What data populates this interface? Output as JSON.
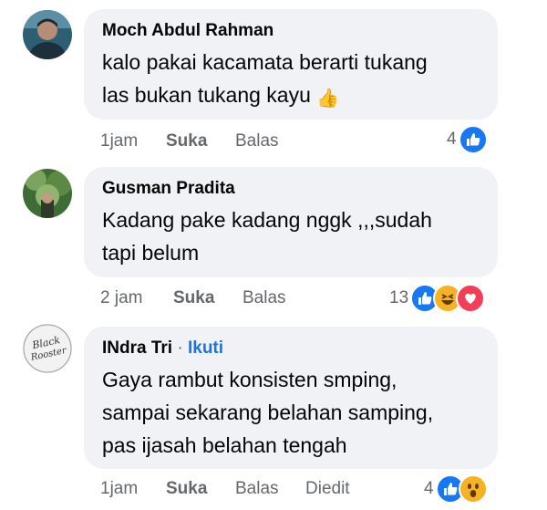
{
  "comments": [
    {
      "author": "Moch Abdul Rahman",
      "text_line1": "kalo pakai kacamata berarti tukang",
      "text_line2": "las bukan tukang kayu",
      "emoji": "👍",
      "time": "1jam",
      "like_label": "Suka",
      "reply_label": "Balas",
      "reaction_count": "4",
      "reactions": [
        "like-icon"
      ]
    },
    {
      "author": "Gusman Pradita",
      "text_line1": "Kadang pake kadang nggk ,,,sudah",
      "text_line2": "tapi belum",
      "time": "2 jam",
      "like_label": "Suka",
      "reply_label": "Balas",
      "reaction_count": "13",
      "reactions": [
        "like-icon",
        "haha-icon",
        "love-icon"
      ]
    },
    {
      "author": "INdra Tri",
      "separator": "·",
      "follow_label": "Ikuti",
      "text_line1": "Gaya rambut konsisten smping,",
      "text_line2": "sampai sekarang belahan samping,",
      "text_line3": "pas ijasah belahan tengah",
      "time": "1jam",
      "like_label": "Suka",
      "reply_label": "Balas",
      "edited_label": "Diedit",
      "reaction_count": "4",
      "reactions": [
        "like-icon",
        "wow-icon"
      ],
      "avatar_text": "Black Rooster"
    }
  ],
  "colors": {
    "bubble": "#f0f2f5",
    "meta": "#65676b",
    "follow": "#1b74e4",
    "like": "#1877f2",
    "love": "#f33e58",
    "haha": "#f7b125"
  }
}
